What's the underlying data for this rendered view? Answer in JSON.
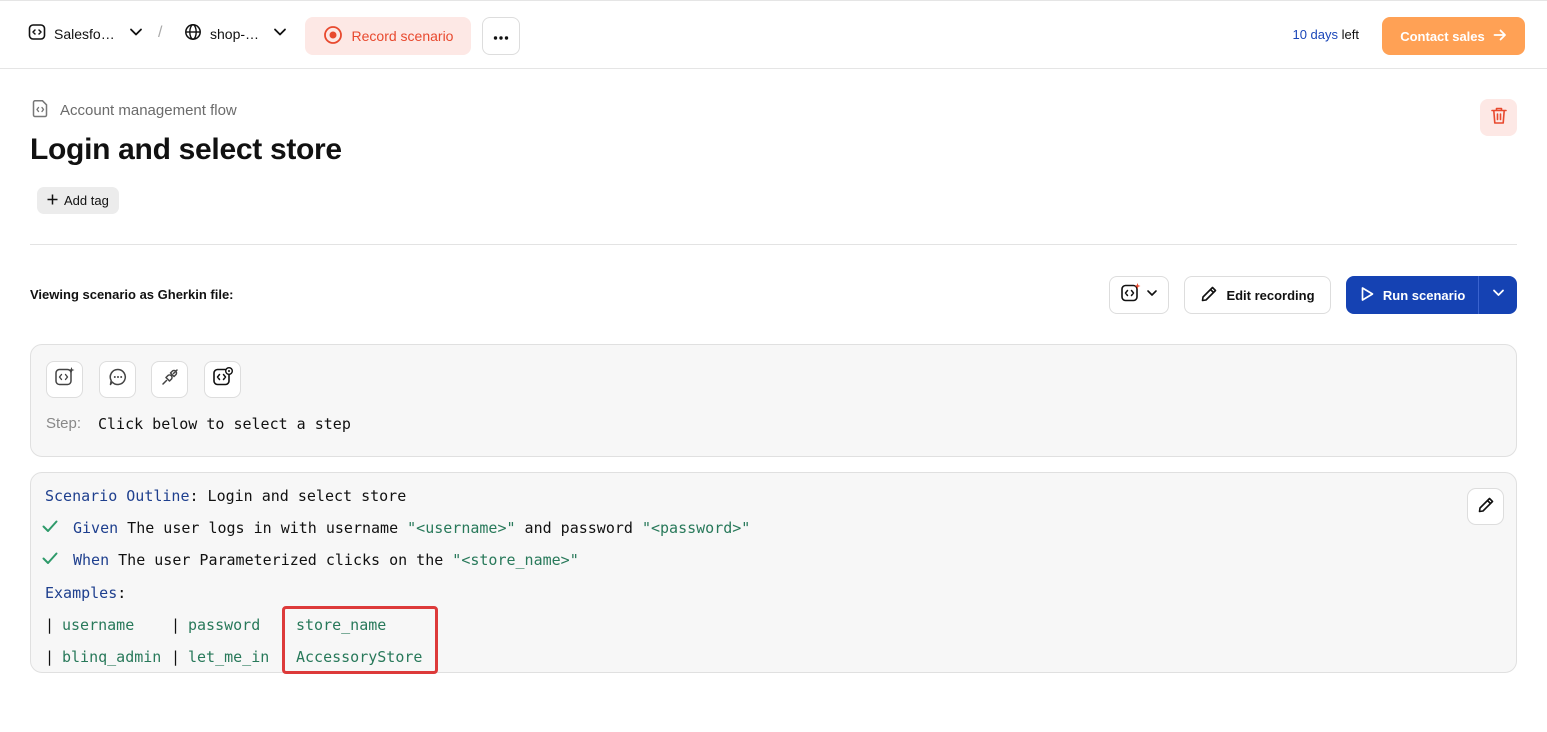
{
  "topbar": {
    "project_label": "Salesfo…",
    "separator": "/",
    "environment_label": "shop-…",
    "record_label": "Record scenario",
    "days_number": "10 days",
    "days_suffix": " left",
    "contact_label": "Contact sales"
  },
  "header": {
    "flow_name": "Account management flow",
    "title": "Login and select store",
    "add_tag_label": "Add tag"
  },
  "viewing": {
    "label": "Viewing scenario as Gherkin file:",
    "edit_recording_label": "Edit recording",
    "run_label": "Run scenario"
  },
  "step_panel": {
    "step_label": "Step:",
    "step_text": "Click below to select a step"
  },
  "gherkin": {
    "outline_keyword": "Scenario Outline",
    "outline_sep": ":",
    "outline_title": " Login and select store",
    "given_keyword": "Given",
    "given_text_1": " The user logs in with username ",
    "given_param_1": "\"<username>\"",
    "given_text_2": " and password ",
    "given_param_2": "\"<password>\"",
    "when_keyword": "When",
    "when_text": " The user Parameterized clicks on the ",
    "when_param": "\"<store_name>\"",
    "examples_keyword": "Examples",
    "examples_sep": ":",
    "table": {
      "pipe": "|",
      "headers": [
        "username",
        "password",
        "store_name"
      ],
      "row": [
        "blinq_admin",
        "let_me_in",
        "AccessoryStore"
      ]
    }
  },
  "colors": {
    "accent_blue": "#1542b3",
    "record_red": "#e8492e",
    "contact_orange": "#ffa155",
    "string_green": "#28795a",
    "highlight_red": "#dd3a3a"
  }
}
